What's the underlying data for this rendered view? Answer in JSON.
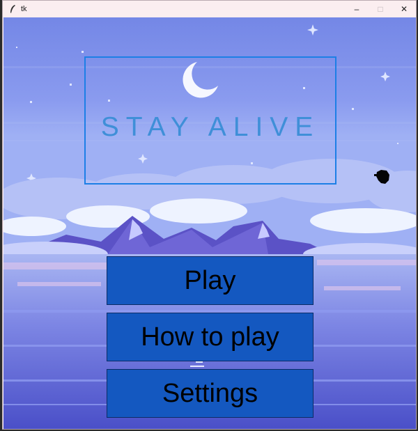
{
  "window": {
    "title": "tk",
    "minimize_glyph": "–",
    "maximize_glyph": "□",
    "close_glyph": "✕"
  },
  "game": {
    "title": "STAY ALIVE",
    "buttons": {
      "play": "Play",
      "how_to_play": "How to play",
      "settings": "Settings"
    }
  },
  "colors": {
    "sky": "#7b8fe8",
    "title_text": "#3f8fd8",
    "title_border": "#1c7fe6",
    "button_fill": "#1458c0",
    "button_text": "#000000"
  },
  "icons": {
    "app": "feather-icon",
    "moon": "crescent-moon-icon",
    "character": "player-silhouette"
  }
}
